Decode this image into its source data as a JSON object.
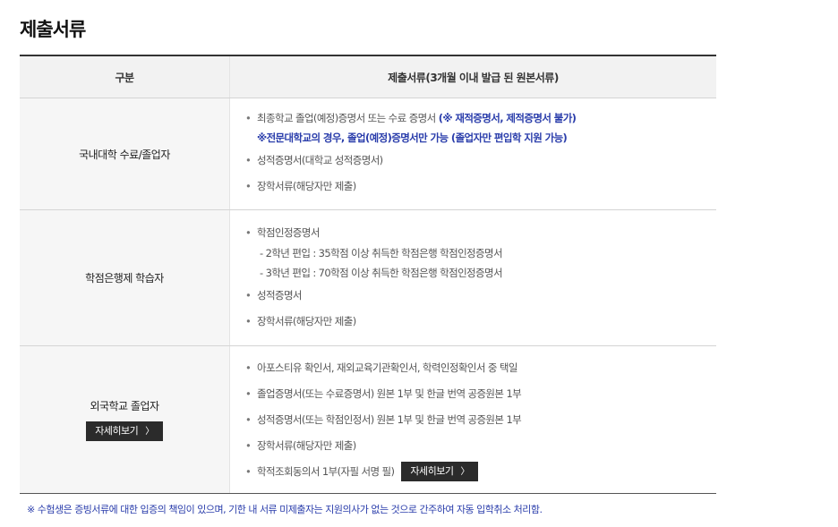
{
  "page_title": "제출서류",
  "table": {
    "headers": [
      "구분",
      "제출서류(3개월 이내 발급 된 원본서류)"
    ],
    "rows": [
      {
        "category": "국내대학 수료/졸업자",
        "items": {
          "i1_text": "최종학교 졸업(예정)증명서 또는 수료 증명서 ",
          "i1_note": "(※ 재적증명서, 제적증명서 불가)",
          "i1_note2": "※전문대학교의 경우, 졸업(예정)증명서만 가능 (졸업자만 편입학 지원 가능)",
          "i2": "성적증명서(대학교 성적증명서)",
          "i3": "장학서류(해당자만 제출)"
        }
      },
      {
        "category": "학점은행제 학습자",
        "items": {
          "i1": "학점인정증명서",
          "i1_sub1": "- 2학년 편입 : 35학점 이상 취득한 학점은행 학점인정증명서",
          "i1_sub2": "- 3학년 편입 : 70학점 이상 취득한 학점은행 학점인정증명서",
          "i2": "성적증명서",
          "i3": "장학서류(해당자만 제출)"
        }
      },
      {
        "category": "외국학교 졸업자",
        "category_button": "자세히보기",
        "items": {
          "i1": "아포스티유 확인서, 재외교육기관확인서, 학력인정확인서 중 택일",
          "i2": "졸업증명서(또는 수료증명서) 원본 1부 및 한글 번역 공증원본 1부",
          "i3": "성적증명서(또는 학점인정서) 원본 1부 및 한글 번역 공증원본 1부",
          "i4": "장학서류(해당자만 제출)",
          "i5": "학적조회동의서 1부(자필 서명 필)",
          "i5_button": "자세히보기"
        }
      }
    ]
  },
  "footnote": "※ 수험생은 증빙서류에 대한 입증의 책임이 있으며, 기한 내 서류 미제출자는 지원의사가 없는 것으로 간주하여 자동 입학취소 처리함.",
  "colors": {
    "accent_blue": "#2a3dab",
    "button_dark": "#2b2b2b",
    "header_bg": "#f2f2f2"
  },
  "icons": {
    "bullet": "bullet-dot-icon",
    "chevron": "chevron-right-icon"
  }
}
